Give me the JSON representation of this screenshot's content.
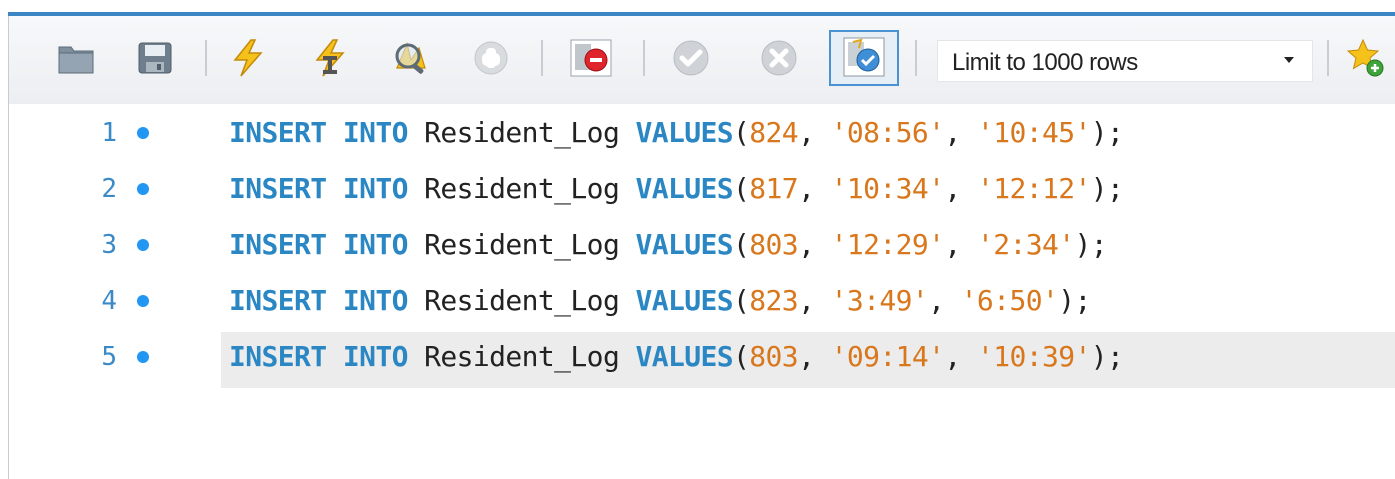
{
  "toolbar": {
    "icons": [
      "open-folder-icon",
      "save-icon",
      "execute-icon",
      "execute-current-icon",
      "explain-icon",
      "stop-icon",
      "toggle-stop-on-error-icon",
      "commit-icon",
      "rollback-icon",
      "toggle-autocommit-icon",
      "add-snippet-icon"
    ],
    "limit_label": "Limit to 1000 rows"
  },
  "editor": {
    "lines": [
      {
        "number": "1",
        "kw1": "INSERT",
        "kw2": "INTO",
        "table": "Resident_Log",
        "kw3": "VALUES",
        "open": "(",
        "num": "824",
        "c1": ",",
        "s1": "'08:56'",
        "c2": ",",
        "s2": "'10:45'",
        "close": ");"
      },
      {
        "number": "2",
        "kw1": "INSERT",
        "kw2": "INTO",
        "table": "Resident_Log",
        "kw3": "VALUES",
        "open": "(",
        "num": "817",
        "c1": ",",
        "s1": "'10:34'",
        "c2": ",",
        "s2": "'12:12'",
        "close": ");"
      },
      {
        "number": "3",
        "kw1": "INSERT",
        "kw2": "INTO",
        "table": "Resident_Log",
        "kw3": "VALUES",
        "open": "(",
        "num": "803",
        "c1": ",",
        "s1": "'12:29'",
        "c2": ",",
        "s2": "'2:34'",
        "close": ");"
      },
      {
        "number": "4",
        "kw1": "INSERT",
        "kw2": "INTO",
        "table": "Resident_Log",
        "kw3": "VALUES",
        "open": "(",
        "num": "823",
        "c1": ",",
        "s1": "'3:49'",
        "c2": ",",
        "s2": "'6:50'",
        "close": ");"
      },
      {
        "number": "5",
        "kw1": "INSERT",
        "kw2": "INTO",
        "table": "Resident_Log",
        "kw3": "VALUES",
        "open": "(",
        "num": "803",
        "c1": ",",
        "s1": "'09:14'",
        "c2": ",",
        "s2": "'10:39'",
        "close": ");"
      }
    ]
  },
  "colors": {
    "keyword": "#2a87c4",
    "literal": "#d9771c",
    "line_number": "#3b8ac8",
    "statement_dot": "#2196f3",
    "current_line": "#ececec",
    "accent_bar": "#3d86c6"
  }
}
